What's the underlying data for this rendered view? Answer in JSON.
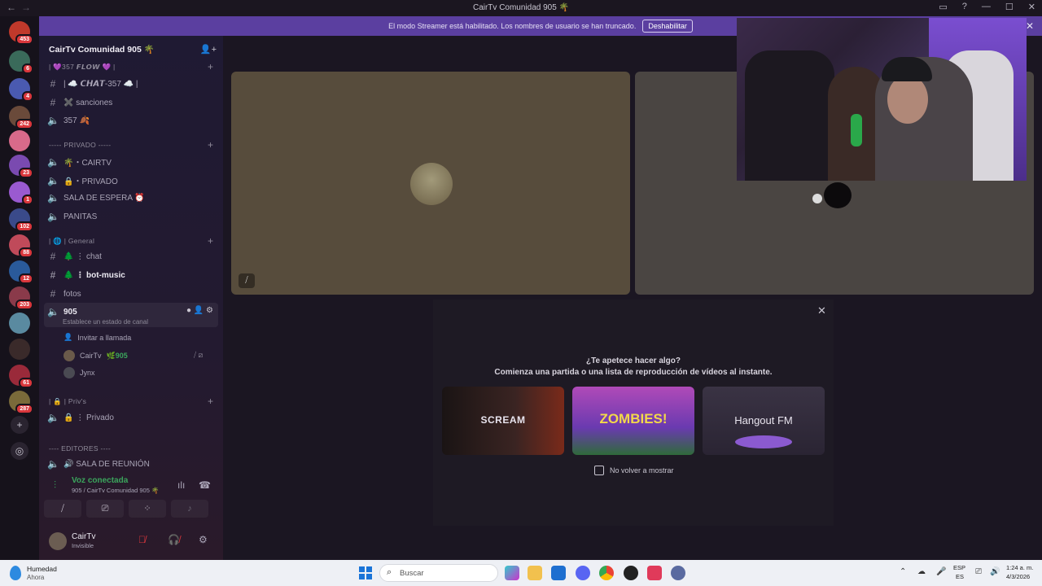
{
  "window": {
    "title": "CairTv Comunidad 905 🌴"
  },
  "banner": {
    "text": "El modo Streamer está habilitado. Los nombres de usuario se han truncado.",
    "button": "Deshabilitar"
  },
  "rail": {
    "servers": [
      {
        "badge": "453",
        "color": "#c0392b"
      },
      {
        "badge": "6",
        "color": "#3a6a5a"
      },
      {
        "badge": "4",
        "color": "#4a5ab0"
      },
      {
        "badge": "242",
        "color": "#6a4a3a"
      },
      {
        "badge": "",
        "color": "#d86a8a"
      },
      {
        "badge": "23",
        "color": "#7a4ab0"
      },
      {
        "badge": "1",
        "color": "#9a5ad0"
      },
      {
        "badge": "102",
        "color": "#3a4a8a"
      },
      {
        "badge": "88",
        "color": "#c04a5a"
      },
      {
        "badge": "12",
        "color": "#2a5a9a"
      },
      {
        "badge": "203",
        "color": "#8a3a4a"
      },
      {
        "badge": "",
        "color": "#5a8aa0"
      },
      {
        "badge": "",
        "color": "#3a2a2a"
      },
      {
        "badge": "61",
        "color": "#9a2a3a"
      },
      {
        "badge": "287",
        "color": "#7a6a3a"
      }
    ]
  },
  "sidebar": {
    "server_name": "CairTv Comunidad 905 🌴",
    "items": [
      {
        "type": "category",
        "label": "| 💜357 𝙁𝙇𝙊𝙒 💜 |"
      },
      {
        "type": "text",
        "label": "| ☁️ 𝘾𝙃𝘼𝙏-357 ☁️ |"
      },
      {
        "type": "text",
        "label": "✖️ sanciones"
      },
      {
        "type": "voice",
        "label": "357 🍂"
      },
      {
        "type": "category",
        "label": "----- PRIVADO -----"
      },
      {
        "type": "voice",
        "label": "🌴・CAIRTV"
      },
      {
        "type": "voice",
        "label": "🔒・PRIVADO"
      },
      {
        "type": "voice",
        "label": "SALA DE ESPERA ⏰"
      },
      {
        "type": "voice",
        "label": "PANITAS"
      },
      {
        "type": "category",
        "label": "| 🌐 | General"
      },
      {
        "type": "text",
        "label": "🌲 ⋮ chat"
      },
      {
        "type": "text",
        "label": "🌲 ⋮ bot-music"
      },
      {
        "type": "text",
        "label": "fotos"
      },
      {
        "type": "voice",
        "label": "905"
      },
      {
        "type": "category",
        "label": "| 🔒 | Priv's"
      },
      {
        "type": "voice",
        "label": "🔒 ⋮ Privado"
      },
      {
        "type": "category",
        "label": "---- EDITORES ----"
      },
      {
        "type": "voice",
        "label": "🔊 SALA DE REUNIÓN"
      }
    ],
    "channel_status": "Establece un estado de canal",
    "invite": "Invitar a llamada",
    "users": [
      {
        "name": "CairTv",
        "tag": "🌿905"
      },
      {
        "name": "Jynx",
        "tag": ""
      }
    ]
  },
  "voice_panel": {
    "title": "Voz conectada",
    "subtitle": "905 / CairTv Comunidad 905 🌴"
  },
  "user_panel": {
    "name": "CairTv",
    "status": "Invisible"
  },
  "activity": {
    "question": "¿Te apetece hacer algo?",
    "subtitle": "Comienza una partida o una lista de reproducción de vídeos al instante.",
    "cards": [
      "SCREAM",
      "ZOMBIES!",
      "Hangout FM"
    ],
    "checkbox_label": "No volver a mostrar"
  },
  "taskbar": {
    "weather": "Humedad",
    "weather_sub": "Ahora",
    "search": "Buscar",
    "lang1": "ESP",
    "lang2": "ES",
    "time": "1:24 a. m.",
    "date": "4/3/2026"
  }
}
